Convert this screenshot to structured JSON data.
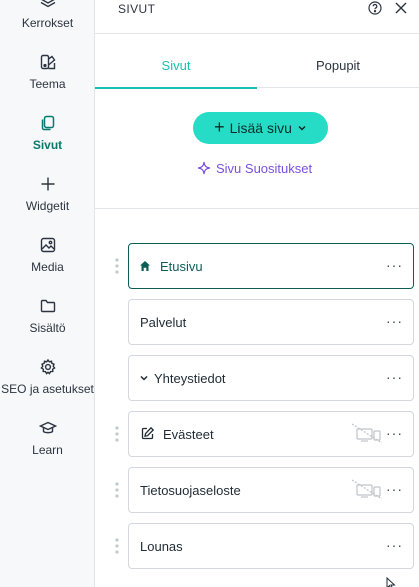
{
  "sidebar": {
    "items": [
      {
        "label": "Kerrokset",
        "icon": "layers-icon"
      },
      {
        "label": "Teema",
        "icon": "palette-icon"
      },
      {
        "label": "Sivut",
        "icon": "pages-icon",
        "active": true
      },
      {
        "label": "Widgetit",
        "icon": "plus-icon"
      },
      {
        "label": "Media",
        "icon": "image-icon"
      },
      {
        "label": "Sisältö",
        "icon": "folder-icon"
      },
      {
        "label": "SEO ja asetukset",
        "icon": "settings-gear-icon"
      },
      {
        "label": "Learn",
        "icon": "graduation-cap-icon"
      }
    ]
  },
  "panel": {
    "title": "SIVUT",
    "tabs": [
      {
        "label": "Sivut",
        "active": true
      },
      {
        "label": "Popupit",
        "active": false
      }
    ],
    "add_button": "Lisää sivu",
    "suggestions_link": "Sivu Suositukset",
    "pages": [
      {
        "name": "Etusivu",
        "lead_icon": "home-icon",
        "active": true,
        "devices_hidden": false
      },
      {
        "name": "Palvelut",
        "lead_icon": "",
        "active": false,
        "devices_hidden": false
      },
      {
        "name": "Yhteystiedot",
        "lead_icon": "chevron-down-icon",
        "active": false,
        "devices_hidden": false
      },
      {
        "name": "Evästeet",
        "lead_icon": "edit-icon",
        "active": false,
        "devices_hidden": true
      },
      {
        "name": "Tietosuojaseloste",
        "lead_icon": "",
        "active": false,
        "devices_hidden": true
      },
      {
        "name": "Lounas",
        "lead_icon": "",
        "active": false,
        "devices_hidden": false
      }
    ],
    "more_glyph": "···"
  },
  "colors": {
    "accent": "#27dcc6",
    "active_tab": "#19c2b0",
    "active_nav": "#07796d",
    "suggest": "#7a4fe0",
    "active_row_border": "#0d5d57"
  }
}
